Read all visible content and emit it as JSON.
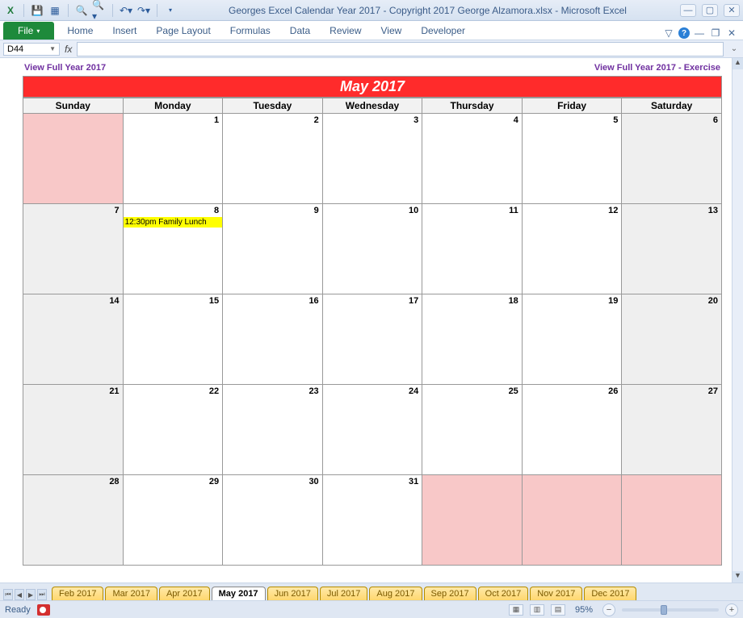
{
  "window": {
    "title": "Georges Excel Calendar Year 2017  -  Copyright 2017 George Alzamora.xlsx  -  Microsoft Excel"
  },
  "ribbon": {
    "file": "File",
    "tabs": [
      "Home",
      "Insert",
      "Page Layout",
      "Formulas",
      "Data",
      "Review",
      "View",
      "Developer"
    ]
  },
  "namebox": {
    "cell": "D44"
  },
  "links": {
    "left": "View Full Year 2017",
    "right": "View Full Year 2017 - Exercise"
  },
  "calendar": {
    "title": "May 2017",
    "days": [
      "Sunday",
      "Monday",
      "Tuesday",
      "Wednesday",
      "Thursday",
      "Friday",
      "Saturday"
    ],
    "weeks": [
      [
        {
          "num": "",
          "cls": "pink"
        },
        {
          "num": "1",
          "cls": "white"
        },
        {
          "num": "2",
          "cls": "white"
        },
        {
          "num": "3",
          "cls": "white"
        },
        {
          "num": "4",
          "cls": "white"
        },
        {
          "num": "5",
          "cls": "white"
        },
        {
          "num": "6",
          "cls": "gray"
        }
      ],
      [
        {
          "num": "7",
          "cls": "gray"
        },
        {
          "num": "8",
          "cls": "white",
          "event": "12:30pm Family Lunch"
        },
        {
          "num": "9",
          "cls": "white"
        },
        {
          "num": "10",
          "cls": "white"
        },
        {
          "num": "11",
          "cls": "white"
        },
        {
          "num": "12",
          "cls": "white"
        },
        {
          "num": "13",
          "cls": "gray"
        }
      ],
      [
        {
          "num": "14",
          "cls": "gray"
        },
        {
          "num": "15",
          "cls": "white"
        },
        {
          "num": "16",
          "cls": "white"
        },
        {
          "num": "17",
          "cls": "white"
        },
        {
          "num": "18",
          "cls": "white"
        },
        {
          "num": "19",
          "cls": "white"
        },
        {
          "num": "20",
          "cls": "gray"
        }
      ],
      [
        {
          "num": "21",
          "cls": "gray"
        },
        {
          "num": "22",
          "cls": "white"
        },
        {
          "num": "23",
          "cls": "white"
        },
        {
          "num": "24",
          "cls": "white"
        },
        {
          "num": "25",
          "cls": "white"
        },
        {
          "num": "26",
          "cls": "white"
        },
        {
          "num": "27",
          "cls": "gray"
        }
      ],
      [
        {
          "num": "28",
          "cls": "gray"
        },
        {
          "num": "29",
          "cls": "white"
        },
        {
          "num": "30",
          "cls": "white"
        },
        {
          "num": "31",
          "cls": "white"
        },
        {
          "num": "",
          "cls": "pink"
        },
        {
          "num": "",
          "cls": "pink"
        },
        {
          "num": "",
          "cls": "pink"
        }
      ]
    ]
  },
  "sheets": {
    "items": [
      "Feb 2017",
      "Mar 2017",
      "Apr 2017",
      "May 2017",
      "Jun 2017",
      "Jul 2017",
      "Aug 2017",
      "Sep 2017",
      "Oct 2017",
      "Nov 2017",
      "Dec 2017"
    ],
    "active": "May 2017"
  },
  "status": {
    "ready": "Ready",
    "zoom": "95%"
  }
}
